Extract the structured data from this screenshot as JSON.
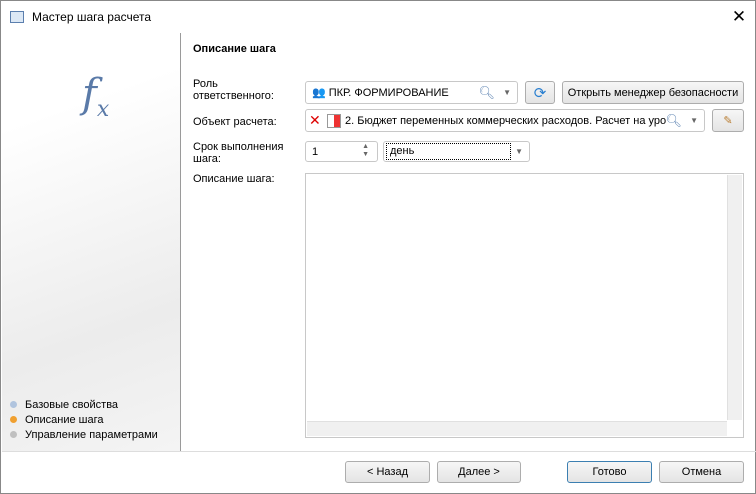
{
  "window": {
    "title": "Мастер шага расчета",
    "close": "✕"
  },
  "sidebar": {
    "steps": [
      {
        "label": "Базовые свойства",
        "color": "#b0c4de"
      },
      {
        "label": "Описание шага",
        "color": "#f0a030"
      },
      {
        "label": "Управление параметрами",
        "color": "#c0c0c0"
      }
    ]
  },
  "section_title": "Описание шага",
  "form": {
    "role_label": "Роль ответственного:",
    "role_value": "ПКР. ФОРМИРОВАНИЕ",
    "open_security_label": "Открыть менеджер безопасности",
    "object_label": "Объект расчета:",
    "object_value": "2. Бюджет переменных коммерческих расходов. Расчет на уро",
    "deadline_label": "Срок выполнения шага:",
    "deadline_value": "1",
    "deadline_unit": "день",
    "description_label": "Описание шага:",
    "description_value": ""
  },
  "footer": {
    "back": "< Назад",
    "next": "Далее >",
    "done": "Готово",
    "cancel": "Отмена"
  }
}
